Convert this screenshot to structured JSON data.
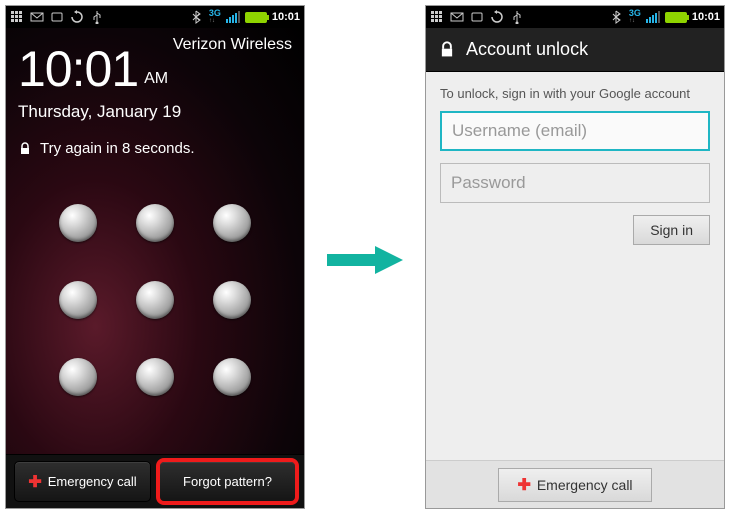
{
  "statusbar": {
    "network_label": "3G",
    "time": "10:01"
  },
  "lock": {
    "carrier": "Verizon Wireless",
    "clock": "10:01",
    "ampm": "AM",
    "date": "Thursday, January 19",
    "message": "Try again in 8 seconds.",
    "emergency_label": "Emergency call",
    "forgot_label": "Forgot pattern?"
  },
  "unlock": {
    "title": "Account unlock",
    "instruction": "To unlock, sign in with your Google account",
    "username_placeholder": "Username (email)",
    "password_placeholder": "Password",
    "signin_label": "Sign in",
    "emergency_label": "Emergency call"
  }
}
